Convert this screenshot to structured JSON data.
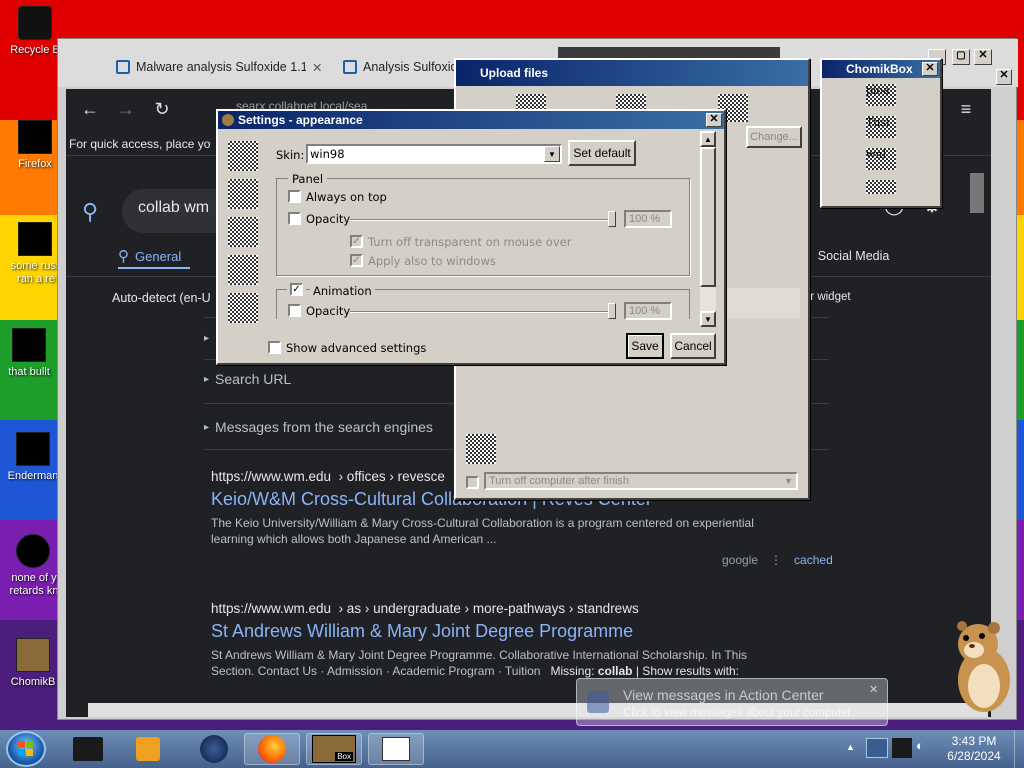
{
  "desktop": {
    "icons": [
      {
        "label": "Recycle B"
      },
      {
        "label": "Firefox"
      },
      {
        "label": "some russ ran a re"
      },
      {
        "label": "that bullt"
      },
      {
        "label": "Enderman"
      },
      {
        "label": "none of y retards kn"
      },
      {
        "label": "ChomikB"
      }
    ]
  },
  "browser": {
    "tabs": [
      {
        "label": "Malware analysis Sulfoxide 1.1",
        "close": "✕"
      },
      {
        "label": "Analysis Sulfoxid"
      }
    ],
    "bookmarks_hint": "For quick access, place yo",
    "url": "searx.collabnet.local/sea",
    "search_query": "collab wm",
    "categories": {
      "general": "General",
      "social": "Social Media"
    },
    "autodetect": "Auto-detect (en-U",
    "widget_hint": "ow or widget",
    "expanders": [
      {
        "label": "Search URL"
      },
      {
        "label": "Messages from the search engines"
      }
    ],
    "results": [
      {
        "url": "https://www.wm.edu",
        "crumb": "› offices › revesce",
        "title": "Keio/W&M Cross-Cultural Collaboration | Reves Center",
        "snippet1": "The Keio University/William & Mary Cross-Cultural Collaboration is a program centered on experiential",
        "snippet2": "learning which allows both Japanese and American ...",
        "engine": "google",
        "sep": "⋮",
        "cached": "cached"
      },
      {
        "url": "https://www.wm.edu",
        "crumb": "› as › undergraduate › more-pathways › standrews",
        "title": "St Andrews William & Mary Joint Degree Programme",
        "snippet1": "St Andrews William & Mary Joint Degree Programme. Collaborative International Scholarship. In This",
        "snippet2": "Section. Contact Us · Admission · Academic Program · Tuition"
      }
    ],
    "missing_prefix": "Missing:",
    "missing_term": "collab",
    "missing_suffix": "| Show results with:"
  },
  "upload_window": {
    "title": "Upload files",
    "change_button": "Change...",
    "turn_off_label": "Turn off computer after finish"
  },
  "chomikbox": {
    "title": "ChomikBox",
    "items": [
      "ploa",
      "Tusi",
      "wnl"
    ]
  },
  "settings": {
    "title": "Settings - appearance",
    "skin_label": "Skin:",
    "skin_value": "win98",
    "set_default": "Set default",
    "panel_group": "Panel",
    "always_on_top": "Always on top",
    "opacity": "Opacity",
    "opacity_value": "100 %",
    "turn_off_transparent": "Turn off transparent on mouse over",
    "apply_windows": "Apply also to windows",
    "animation": "Animation",
    "opacity2": "Opacity",
    "opacity2_value": "100 %",
    "show_advanced": "Show advanced settings",
    "save": "Save",
    "cancel": "Cancel"
  },
  "notification": {
    "title": "View messages in Action Center",
    "body": "Click to view messages about your computer."
  },
  "taskbar": {
    "time": "3:43 PM",
    "date": "6/28/2024",
    "box_label": "Box"
  }
}
